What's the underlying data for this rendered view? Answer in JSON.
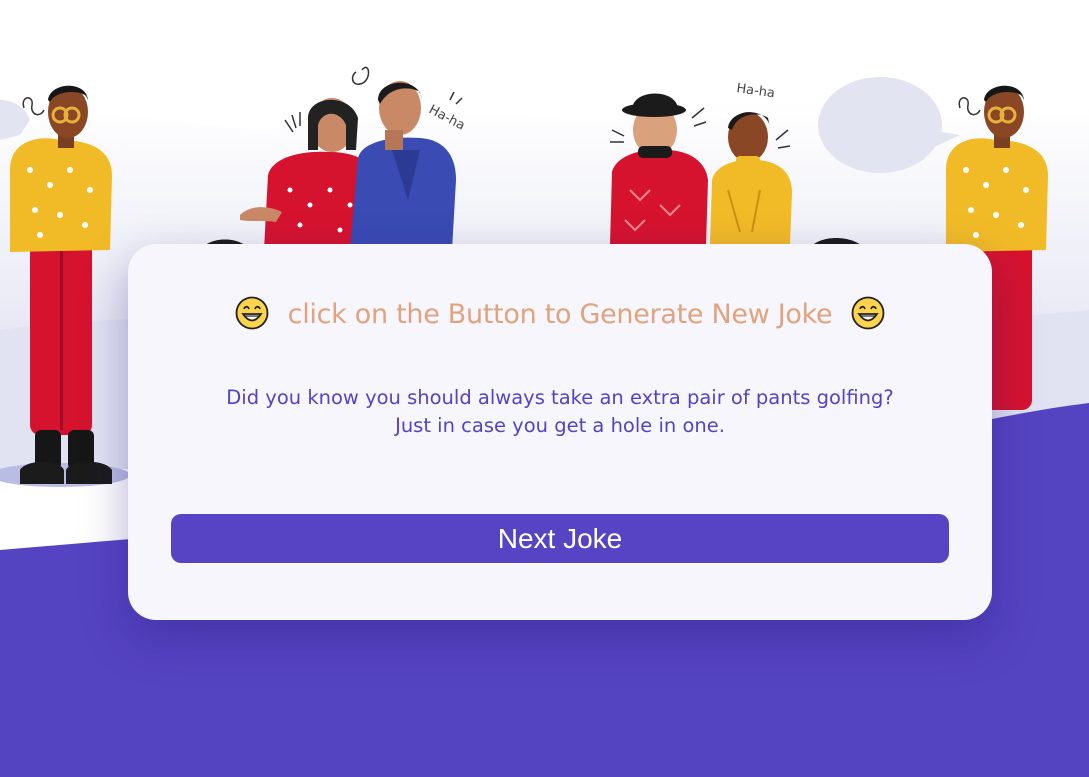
{
  "heading": {
    "text": "click on the Button to Generate New Joke",
    "left_emoji_icon": "grinning-face-icon",
    "right_emoji_icon": "grinning-face-icon"
  },
  "joke": {
    "setup": "Did you know you should always take an extra pair of pants golfing?",
    "punchline": "Just in case you get a hole in one."
  },
  "next_button": {
    "label": "Next Joke"
  },
  "illustration": {
    "speech_1": "Ha-ha",
    "speech_2": "Ha-ha"
  },
  "colors": {
    "accent": "#5644c4",
    "heading": "#e0a37f",
    "card": "#f6f6fc"
  }
}
